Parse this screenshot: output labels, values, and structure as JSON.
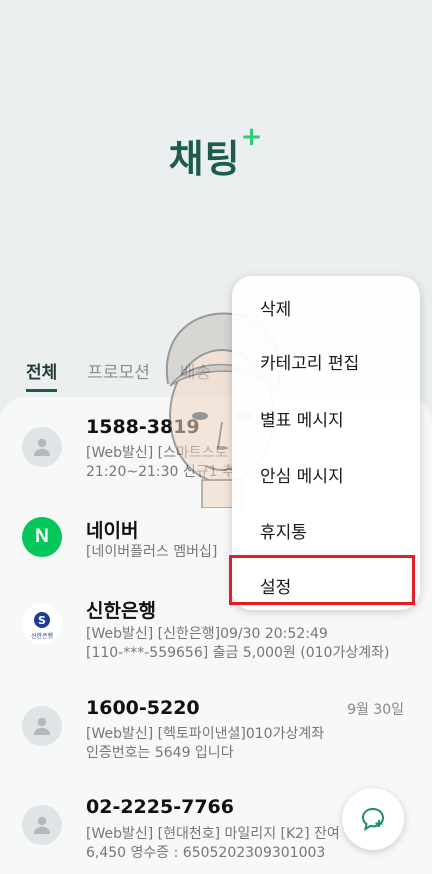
{
  "header": {
    "title": "채팅",
    "title_plus": "+"
  },
  "tabs": [
    {
      "label": "전체",
      "active": true
    },
    {
      "label": "프로모션"
    },
    {
      "label": "배송"
    }
  ],
  "messages": [
    {
      "name": "1588-3819",
      "line1": "[Web발신] [스마트스토",
      "line2": "21:20~21:30 신규1 추",
      "avatar": "person-icon"
    },
    {
      "name": "네이버",
      "line1": "[네이버플러스 멤버십]",
      "line2": "",
      "avatar": "naver-logo",
      "avatar_text": "N"
    },
    {
      "name": "신한은행",
      "line1": "[Web발신] [신한은행]09/30 20:52:49",
      "line2": "[110-***-559656] 출금 5,000원 (010가상계좌)",
      "avatar": "shinhan-logo",
      "avatar_text": "신한은행"
    },
    {
      "name": "1600-5220",
      "date": "9월 30일",
      "line1": "[Web발신] [헥토파이낸셜]010가상계좌",
      "line2": "인증번호는 5649 입니다",
      "avatar": "person-icon"
    },
    {
      "name": "02-2225-7766",
      "line1": "[Web발신] [현대천호] 마일리지 [K2] 잔여",
      "line2": "6,450 영수증 : 6505202309301003",
      "avatar": "person-icon"
    }
  ],
  "menu": {
    "items": [
      "삭제",
      "카테고리 편집",
      "별표 메시지",
      "안심 메시지",
      "휴지통",
      "설정"
    ]
  },
  "colors": {
    "accent": "#1d5b4f",
    "plus": "#2ecc71",
    "highlight": "#e21f26"
  }
}
